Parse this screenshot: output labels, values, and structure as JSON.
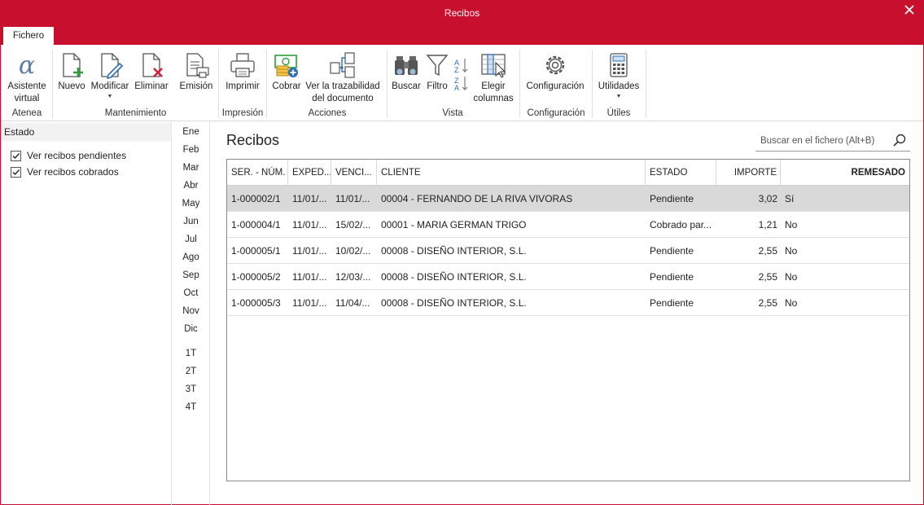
{
  "window": {
    "title": "Recibos"
  },
  "tabs": {
    "fichero": "Fichero"
  },
  "ribbon": {
    "asistente": "Asistente virtual",
    "nuevo": "Nuevo",
    "modificar": "Modificar",
    "eliminar": "Eliminar",
    "emision": "Emisión",
    "imprimir": "Imprimir",
    "cobrar": "Cobrar",
    "trazabilidad": "Ver la trazabilidad del documento",
    "buscar": "Buscar",
    "filtro": "Filtro",
    "elegir": "Elegir columnas",
    "configuracion": "Configuración",
    "utilidades": "Utilidades",
    "groups": {
      "atenea": "Atenea",
      "mantenimiento": "Mantenimiento",
      "impresion": "Impresión",
      "acciones": "Acciones",
      "vista": "Vista",
      "configuracion": "Configuración",
      "utiles": "Útiles"
    }
  },
  "left": {
    "estado": "Estado",
    "checks": [
      {
        "label": "Ver recibos pendientes",
        "checked": true
      },
      {
        "label": "Ver recibos cobrados",
        "checked": true
      }
    ]
  },
  "months": [
    "Ene",
    "Feb",
    "Mar",
    "Abr",
    "May",
    "Jun",
    "Jul",
    "Ago",
    "Sep",
    "Oct",
    "Nov",
    "Dic"
  ],
  "quarters": [
    "1T",
    "2T",
    "3T",
    "4T"
  ],
  "main": {
    "title": "Recibos",
    "search_placeholder": "Buscar en el fichero (Alt+B)"
  },
  "table": {
    "headers": [
      "SER. - NÚM.",
      "EXPED...",
      "VENCI...",
      "CLIENTE",
      "ESTADO",
      "IMPORTE",
      "REMESADO"
    ],
    "rows": [
      [
        "1-000002/1",
        "11/01/...",
        "11/01/...",
        "00004 - FERNANDO DE LA RIVA VIVORAS",
        "Pendiente",
        "3,02",
        "Sí"
      ],
      [
        "1-000004/1",
        "11/01/...",
        "15/02/...",
        "00001 - MARIA GERMAN TRIGO",
        "Cobrado par...",
        "1,21",
        "No"
      ],
      [
        "1-000005/1",
        "11/01/...",
        "10/02/...",
        "00008 - DISEÑO INTERIOR, S.L.",
        "Pendiente",
        "2,55",
        "No"
      ],
      [
        "1-000005/2",
        "11/01/...",
        "12/03/...",
        "00008 - DISEÑO INTERIOR, S.L.",
        "Pendiente",
        "2,55",
        "No"
      ],
      [
        "1-000005/3",
        "11/01/...",
        "11/04/...",
        "00008 - DISEÑO INTERIOR, S.L.",
        "Pendiente",
        "2,55",
        "No"
      ]
    ],
    "selected_row": 0
  },
  "colors": {
    "accent": "#c8102e",
    "selection": "#d9d9d9"
  }
}
